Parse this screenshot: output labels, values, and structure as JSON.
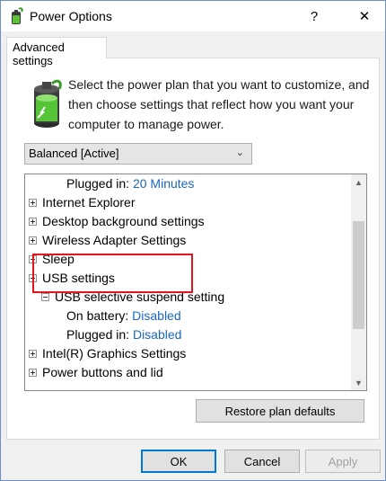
{
  "window": {
    "title": "Power Options",
    "help_label": "?",
    "close_label": "✕"
  },
  "tab": {
    "label": "Advanced settings"
  },
  "intro_text": "Select the power plan that you want to customize, and then choose settings that reflect how you want your computer to manage power.",
  "plan_select": {
    "value": "Balanced [Active]"
  },
  "tree": {
    "rows": [
      {
        "label": "Plugged in:",
        "value": "20 Minutes"
      },
      {
        "label": "Internet Explorer"
      },
      {
        "label": "Desktop background settings"
      },
      {
        "label": "Wireless Adapter Settings"
      },
      {
        "label": "Sleep"
      },
      {
        "label": "USB settings"
      },
      {
        "label": "USB selective suspend setting"
      },
      {
        "label": "On battery:",
        "value": "Disabled"
      },
      {
        "label": "Plugged in:",
        "value": "Disabled"
      },
      {
        "label": "Intel(R) Graphics Settings"
      },
      {
        "label": "Power buttons and lid"
      }
    ]
  },
  "buttons": {
    "restore": "Restore plan defaults",
    "ok": "OK",
    "cancel": "Cancel",
    "apply": "Apply"
  },
  "colors": {
    "link": "#1a66c2",
    "highlight": "#e5141e",
    "focus": "#0078d7"
  }
}
